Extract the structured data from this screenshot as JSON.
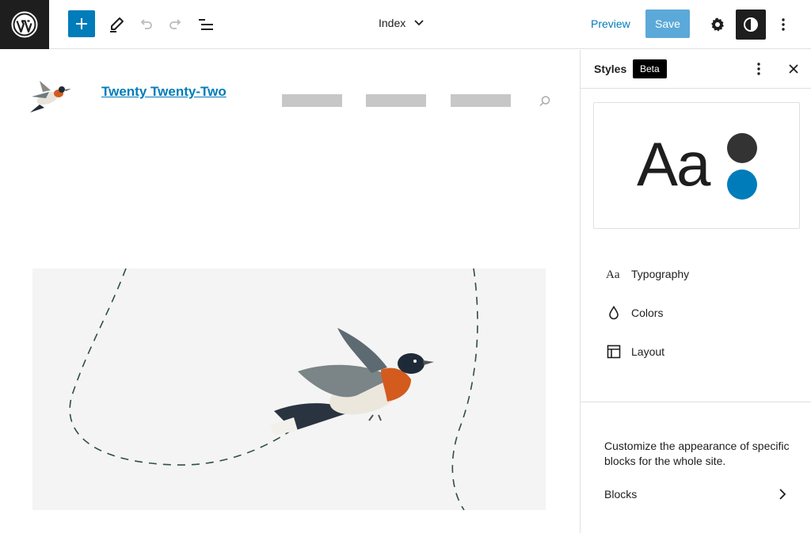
{
  "toolbar": {
    "logo_icon": "wordpress-logo",
    "add_label": "Add block",
    "document_title": "Index",
    "preview_label": "Preview",
    "save_label": "Save",
    "colors": {
      "accent": "#007cba",
      "save_disabled": "#5ba9d8",
      "dark": "#1e1e1e"
    }
  },
  "canvas": {
    "site_title": "Twenty Twenty-Two",
    "nav_placeholders": 3,
    "colors": {
      "hero_bg": "#f4f4f4",
      "placeholder": "#c7c7c7",
      "dash": "#2f4f43"
    }
  },
  "sidebar": {
    "title": "Styles",
    "badge": "Beta",
    "preview_text": "Aa",
    "preview_colors": [
      "#333333",
      "#007cba"
    ],
    "items": [
      {
        "label": "Typography",
        "icon": "typography-icon"
      },
      {
        "label": "Colors",
        "icon": "droplet-icon"
      },
      {
        "label": "Layout",
        "icon": "layout-icon"
      }
    ],
    "description": "Customize the appearance of specific blocks for the whole site.",
    "blocks_label": "Blocks"
  }
}
